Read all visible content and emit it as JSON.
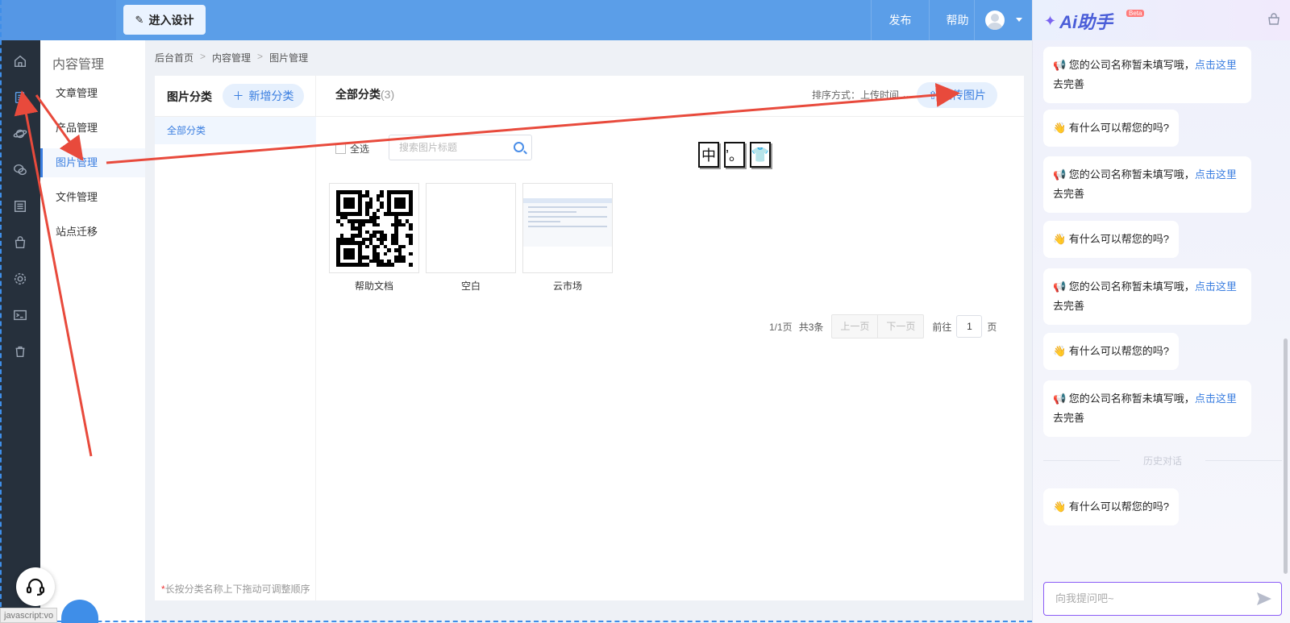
{
  "header": {
    "design_button": "进入设计",
    "publish": "发布",
    "help": "帮助"
  },
  "subnav": {
    "title": "内容管理",
    "items": [
      {
        "label": "文章管理"
      },
      {
        "label": "产品管理"
      },
      {
        "label": "图片管理"
      },
      {
        "label": "文件管理"
      },
      {
        "label": "站点迁移"
      }
    ]
  },
  "breadcrumb": [
    "后台首页",
    "内容管理",
    "图片管理"
  ],
  "category": {
    "title": "图片分类",
    "add_button": "新增分类",
    "items": [
      "全部分类"
    ],
    "hint": "长按分类名称上下拖动可调整顺序"
  },
  "gallery": {
    "title": "全部分类",
    "count": "(3)",
    "sort_label": "排序方式：上传时间",
    "upload_button": "上传图片",
    "select_all": "全选",
    "search_placeholder": "搜索图片标题",
    "glyphs": [
      "中",
      "’。",
      "👕"
    ],
    "images": [
      {
        "label": "帮助文档"
      },
      {
        "label": "空白"
      },
      {
        "label": "云市场"
      }
    ]
  },
  "pager": {
    "page_info": "1/1页",
    "total": "共3条",
    "prev": "上一页",
    "next": "下一页",
    "goto": "前往",
    "page_value": "1",
    "page_unit": "页"
  },
  "ai": {
    "title": "Ai助手",
    "beta": "Beta",
    "messages": [
      {
        "pre": "📢 您的公司名称暂未填写哦，",
        "link": "点击这里",
        "post": " 去完善"
      },
      {
        "pre": "👋 有什么可以帮您的吗?"
      },
      {
        "pre": "📢 您的公司名称暂未填写哦，",
        "link": "点击这里",
        "post": " 去完善"
      },
      {
        "pre": "👋 有什么可以帮您的吗?"
      },
      {
        "pre": "📢 您的公司名称暂未填写哦，",
        "link": "点击这里",
        "post": " 去完善"
      },
      {
        "pre": "👋 有什么可以帮您的吗?"
      },
      {
        "pre": "📢 您的公司名称暂未填写哦，",
        "link": "点击这里",
        "post": " 去完善"
      },
      {
        "pre": "👋 有什么可以帮您的吗?"
      }
    ],
    "history_divider": "历史对话",
    "input_placeholder": "向我提问吧~"
  },
  "status_bar": "javascript:vo",
  "colors": {
    "accent": "#3a7ee0",
    "header": "#5b9ee8",
    "rail": "#26303c",
    "arrow": "#e84a3c"
  }
}
